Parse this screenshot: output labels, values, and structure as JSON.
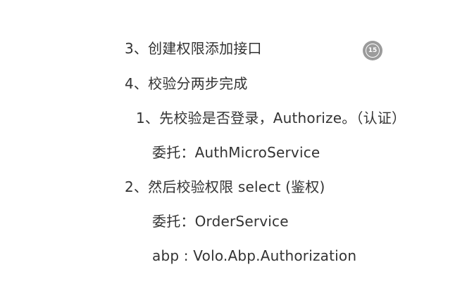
{
  "lines": [
    "3、创建权限添加接口",
    "4、校验分两步完成",
    "1、先校验是否登录，Authorize。（认证）",
    "委托：AuthMicroService",
    "2、然后校验权限 select (鉴权)",
    "委托：OrderService",
    "abp : Volo.Abp.Authorization"
  ],
  "badge": {
    "number": "15",
    "color": "#9b9b9b"
  }
}
